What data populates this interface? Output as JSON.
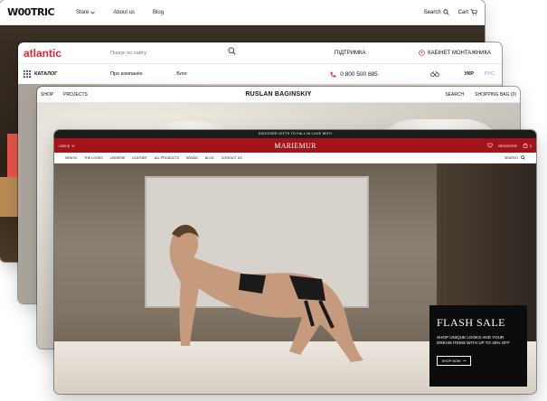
{
  "woodtric": {
    "logo": "W00TRIC",
    "nav": [
      "Store",
      "About us",
      "Blog"
    ],
    "search_label": "Search",
    "cart_label": "Cart"
  },
  "atlantic": {
    "logo": "atlantic",
    "search_placeholder": "Пошук по сайту",
    "support": "ПІДТРИМКА",
    "cabinet": "КАБІНЕТ МОНТАЖНИКА",
    "catalog": "КАТАЛОГ",
    "about": "Про компанію",
    "blog": "Блог",
    "phone": "0 800 500 885",
    "lang_active": "УКР",
    "lang_other": "РУС",
    "accent": "#e3262f"
  },
  "ruslan": {
    "left_nav": [
      "SHOP",
      "PROJECTS"
    ],
    "brand": "RUSLAN BAGINSKIY",
    "search": "SEARCH",
    "bag": "SHOPPING BAG (0)"
  },
  "mariemur": {
    "promo": "DISCOVER GIFTS TO FALL IN LOVE WITH",
    "currency": "USD $",
    "brand": "MARIEMUR",
    "register": "REGISTER",
    "count": "0",
    "menu": [
      "NEW IN",
      "THE LOOKS",
      "LINGERIE",
      "LEATHER",
      "ALL PRODUCTS",
      "BRAND",
      "BLOG",
      "CONTACT US"
    ],
    "search": "SEARCH",
    "accent": "#a3131a",
    "flash": {
      "title": "FLASH SALE",
      "desc": "SHOP UNIQUE LOOKS AND YOUR DREAM ITEMS WITH UP TO 40% OFF",
      "button": "SHOP NOW"
    }
  }
}
